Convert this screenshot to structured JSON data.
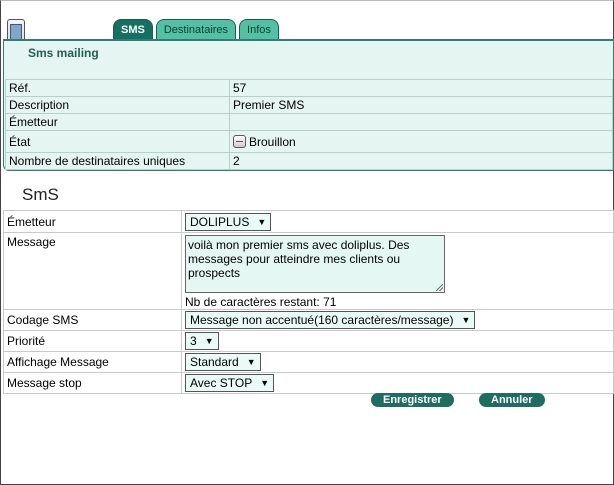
{
  "tabs": [
    {
      "label": "SMS",
      "active": true
    },
    {
      "label": "Destinataires",
      "active": false
    },
    {
      "label": "Infos",
      "active": false
    }
  ],
  "mailing": {
    "title": "Sms mailing",
    "rows": [
      {
        "label": "Réf.",
        "value": "57"
      },
      {
        "label": "Description",
        "value": "Premier SMS"
      },
      {
        "label": "Émetteur",
        "value": ""
      },
      {
        "label": "État",
        "value": "Brouillon"
      },
      {
        "label": "Nombre de destinataires uniques",
        "value": "2"
      }
    ]
  },
  "sms_section": {
    "title": "SmS",
    "sender_label": "Émetteur",
    "sender_value": "DOLIPLUS",
    "message_label": "Message",
    "message_text": "voilà mon premier sms avec doliplus. Des messages pour atteindre mes clients ou prospects",
    "remaining_label": "Nb de caractères restant: 71",
    "encoding_label": "Codage SMS",
    "encoding_value": "Message non accentué(160 caractères/message)",
    "priority_label": "Priorité",
    "priority_value": "3",
    "display_label": "Affichage Message",
    "display_value": "Standard",
    "stop_label": "Message stop",
    "stop_value": "Avec STOP"
  },
  "actions": {
    "save": "Enregistrer",
    "cancel": "Annuler"
  },
  "icons": {
    "app": "phone-icon",
    "state": "draft-status-icon",
    "dropdown": "chevron-down-icon"
  },
  "colors": {
    "accent": "#1e6d60",
    "panel": "#e4f5f2"
  }
}
